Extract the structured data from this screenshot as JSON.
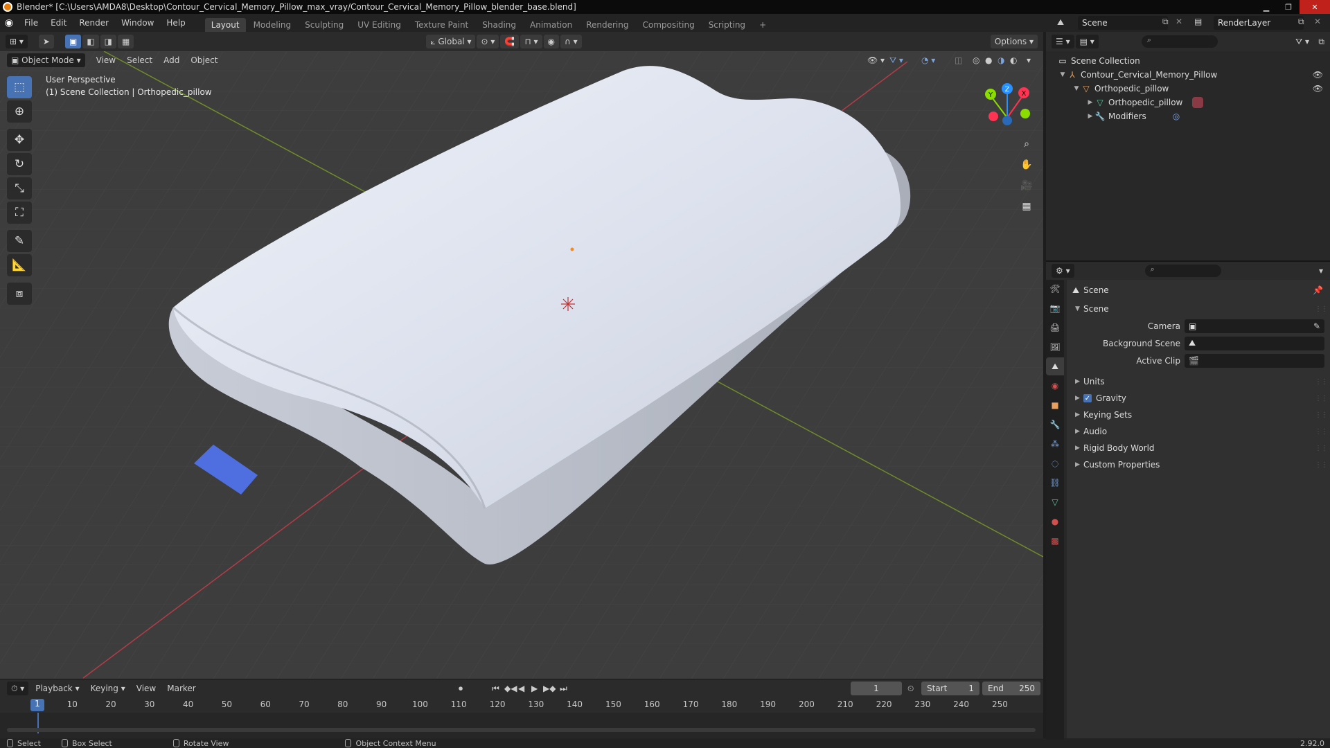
{
  "window": {
    "title": "Blender* [C:\\Users\\AMDA8\\Desktop\\Contour_Cervical_Memory_Pillow_max_vray/Contour_Cervical_Memory_Pillow_blender_base.blend]"
  },
  "menu": {
    "items": [
      "File",
      "Edit",
      "Render",
      "Window",
      "Help"
    ]
  },
  "workspaces": {
    "tabs": [
      "Layout",
      "Modeling",
      "Sculpting",
      "UV Editing",
      "Texture Paint",
      "Shading",
      "Animation",
      "Rendering",
      "Compositing",
      "Scripting"
    ],
    "add": "+"
  },
  "scene_selector": {
    "name": "Scene"
  },
  "view_layer_selector": {
    "name": "RenderLayer"
  },
  "viewport_header": {
    "orientation": "Global",
    "options": "Options",
    "mode": "Object Mode",
    "menus": [
      "View",
      "Select",
      "Add",
      "Object"
    ]
  },
  "viewport": {
    "perspective_label": "User Perspective",
    "collection_label": "(1) Scene Collection | Orthopedic_pillow",
    "gizmo_axes": {
      "x": "X",
      "y": "Y",
      "z": "Z"
    }
  },
  "timeline": {
    "menus": [
      "Playback",
      "Keying",
      "View",
      "Marker"
    ],
    "current_frame": "1",
    "start_label": "Start",
    "start": "1",
    "end_label": "End",
    "end": "250",
    "ruler": [
      1,
      10,
      20,
      30,
      40,
      50,
      60,
      70,
      80,
      90,
      100,
      110,
      120,
      130,
      140,
      150,
      160,
      170,
      180,
      190,
      200,
      210,
      220,
      230,
      240,
      250
    ]
  },
  "statusbar": {
    "select": "Select",
    "box_select": "Box Select",
    "rotate_view": "Rotate View",
    "context_menu": "Object Context Menu",
    "version": "2.92.0"
  },
  "outliner": {
    "root": "Scene Collection",
    "rows": [
      {
        "label": "Contour_Cervical_Memory_Pillow",
        "depth": 1
      },
      {
        "label": "Orthopedic_pillow",
        "depth": 2
      },
      {
        "label": "Orthopedic_pillow",
        "depth": 3
      },
      {
        "label": "Modifiers",
        "depth": 3
      }
    ]
  },
  "properties": {
    "context": "Scene",
    "panel_title": "Scene",
    "fields": [
      {
        "label": "Camera",
        "value": ""
      },
      {
        "label": "Background Scene",
        "value": ""
      },
      {
        "label": "Active Clip",
        "value": ""
      }
    ],
    "sections": [
      "Units",
      "Gravity",
      "Keying Sets",
      "Audio",
      "Rigid Body World",
      "Custom Properties"
    ]
  },
  "colors": {
    "accent": "#4772b3",
    "x_axis": "#ff3352",
    "y_axis": "#8bdc00",
    "z_axis": "#2890ff",
    "mesh": "#dde2ee"
  }
}
